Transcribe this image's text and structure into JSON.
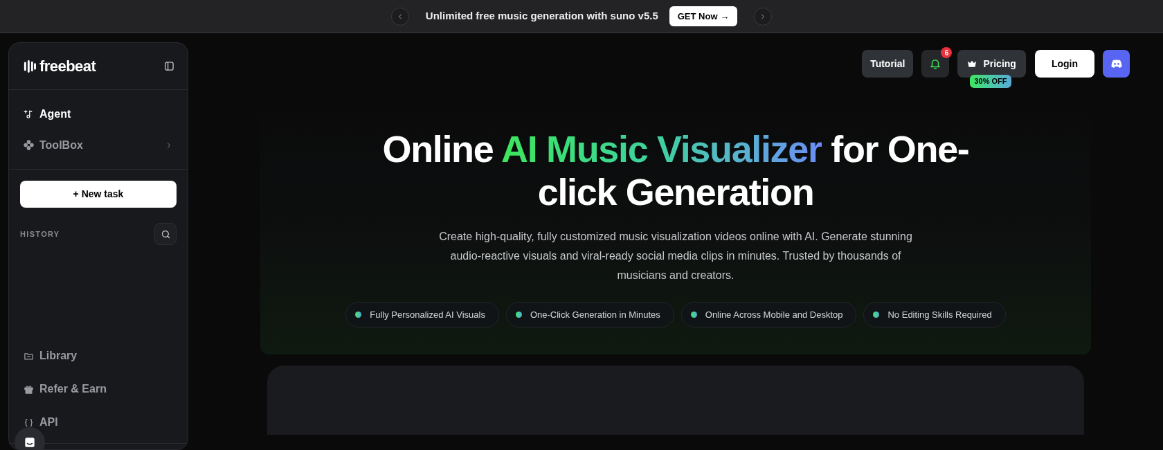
{
  "announcement": {
    "text": "Unlimited free music generation with suno v5.5",
    "button": "GET Now →"
  },
  "sidebar": {
    "logo": "freebeat",
    "nav": [
      {
        "label": "Agent",
        "kind": "agent",
        "selected": true,
        "chevron": false
      },
      {
        "label": "ToolBox",
        "kind": "toolbox",
        "selected": false,
        "chevron": true
      }
    ],
    "new_task": "+ New task",
    "history_label": "HISTORY",
    "bottom": [
      {
        "label": "Library",
        "kind": "folder"
      },
      {
        "label": "Refer & Earn",
        "kind": "gift"
      },
      {
        "label": "API",
        "kind": "braces"
      }
    ]
  },
  "header": {
    "tutorial": "Tutorial",
    "notifications": "6",
    "pricing": "Pricing",
    "pricing_badge": "30% OFF",
    "login": "Login"
  },
  "hero": {
    "title_before": "Online ",
    "title_highlight": "AI Music Visualizer",
    "title_after": " for One-click Generation",
    "subtitle": "Create high-quality, fully customized music visualization videos online with AI. Generate stunning audio-reactive visuals and viral-ready social media clips in minutes. Trusted by thousands of musicians and creators.",
    "features": [
      "Fully Personalized AI Visuals",
      "One-Click Generation in Minutes",
      "Online Across Mobile and Desktop",
      "No Editing Skills Required"
    ]
  }
}
